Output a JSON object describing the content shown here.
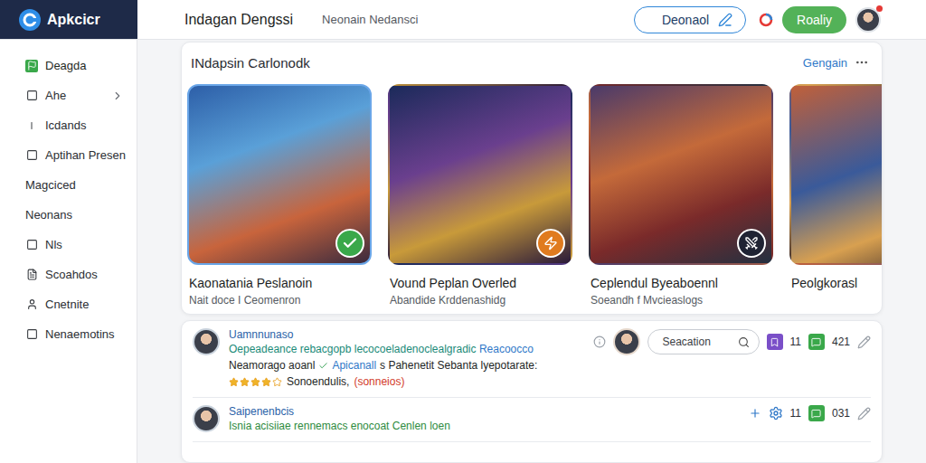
{
  "app": {
    "logo": "Apkcicr",
    "title": "Indagan Dengssi",
    "search": {
      "placeholder": "Neonain Nedansci"
    },
    "buttons": [
      {
        "label": "Deonaol",
        "kind": "outline"
      },
      {
        "label": "Roaliy",
        "kind": "primary"
      }
    ],
    "notification": true
  },
  "sidebar": {
    "items": [
      {
        "label": "Deagda",
        "kind": "flag",
        "selected": true
      },
      {
        "label": "Ahe",
        "kind": "box",
        "selected": false,
        "expanded": false
      },
      {
        "label": "Icdands",
        "kind": "bar",
        "selected": false
      },
      {
        "label": "Aptihan Presen",
        "kind": "box",
        "selected": false
      },
      {
        "label": "Magciced",
        "kind": "plain",
        "selected": false
      },
      {
        "label": "Neonans",
        "kind": "plain",
        "selected": false
      },
      {
        "label": "Nls",
        "kind": "box",
        "selected": false
      },
      {
        "label": "Scoahdos",
        "kind": "doc",
        "selected": false
      },
      {
        "label": "Cnetnite",
        "kind": "user",
        "selected": false
      },
      {
        "label": "Nenaemotins",
        "kind": "box",
        "selected": false
      }
    ]
  },
  "section": {
    "title": "INdapsin Carlonodk",
    "link": "Gengain"
  },
  "games": [
    {
      "title": "Kaonatania Peslanoin",
      "subtitle": "Nait doce I Ceomenron",
      "badge": "check",
      "color": "#3aa84a"
    },
    {
      "title": "Vound Peplan Overled",
      "subtitle": "Abandide Krddenashidg",
      "badge": "bolt",
      "color": "#e07b1f"
    },
    {
      "title": "Ceplendul Byeaboennl",
      "subtitle": "Soeandh f Mvcieaslogs",
      "badge": "swords",
      "color": "#1f2333"
    },
    {
      "title": "Peolgkorasl"
    }
  ],
  "feed": {
    "posts": [
      {
        "author": "Uamnnunaso",
        "text": "Oepeadeance rebacgopb lecocoeladenoclealgradic",
        "link": "Reacoocco",
        "search": {
          "placeholder": "Seacation"
        },
        "counts": [
          "11",
          "421"
        ],
        "body": {
          "before": "Neamorago aoanl",
          "link": "Apicanall",
          "after": "s Pahenetit Sebanta lyepotarate:"
        },
        "rating": {
          "stars": 4,
          "label": "Sonoendulis,",
          "note": "(sonneios)"
        }
      },
      {
        "author": "Saipenenbcis",
        "text": "Isnia acisiiae rennemacs enocoat Cenlen loen",
        "counts": [
          "11",
          "031"
        ]
      }
    ]
  }
}
